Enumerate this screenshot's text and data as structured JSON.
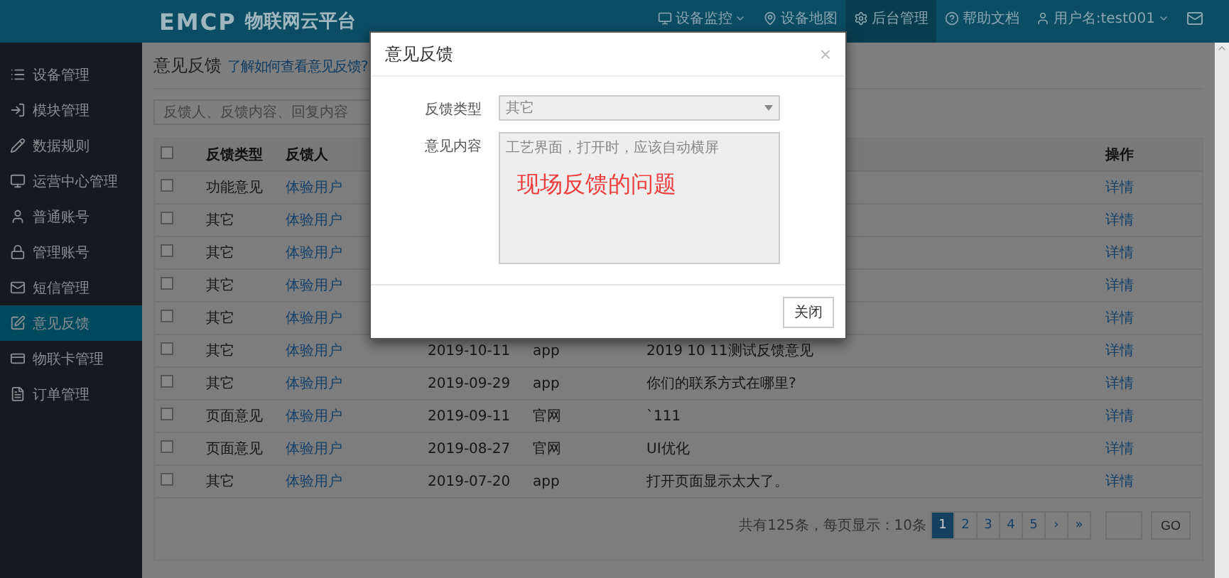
{
  "header": {
    "logo": "EMCP",
    "brand": "物联网云平台",
    "nav": [
      {
        "label": "设备监控",
        "caret": true,
        "selected": false
      },
      {
        "label": "设备地图",
        "caret": false,
        "selected": false
      },
      {
        "label": "后台管理",
        "caret": false,
        "selected": true
      },
      {
        "label": "帮助文档",
        "caret": false,
        "selected": false
      },
      {
        "label": "用户名:test001",
        "caret": true,
        "selected": false
      },
      {
        "caret": false,
        "selected": false
      }
    ]
  },
  "sidebar": {
    "items": [
      {
        "label": "设备管理",
        "selected": false
      },
      {
        "label": "模块管理",
        "selected": false
      },
      {
        "label": "数据规则",
        "selected": false
      },
      {
        "label": "运营中心管理",
        "selected": false
      },
      {
        "label": "普通账号",
        "selected": false
      },
      {
        "label": "管理账号",
        "selected": false
      },
      {
        "label": "短信管理",
        "selected": false
      },
      {
        "label": "意见反馈",
        "selected": true
      },
      {
        "label": "物联卡管理",
        "selected": false
      },
      {
        "label": "订单管理",
        "selected": false
      }
    ]
  },
  "page": {
    "title": "意见反馈",
    "help_link": "了解如何查看意见反馈?",
    "search": {
      "placeholder": "反馈人、反馈内容、回复内容"
    }
  },
  "table": {
    "all_checked": false,
    "columns": [
      "反馈类型",
      "反馈人",
      "操作"
    ],
    "rows": [
      {
        "checked": false,
        "type": "功能意见",
        "person": "体验用户",
        "action": "详情"
      },
      {
        "checked": false,
        "type": "其它",
        "person": "体验用户",
        "action": "详情"
      },
      {
        "checked": false,
        "type": "其它",
        "person": "体验用户",
        "action": "详情"
      },
      {
        "checked": false,
        "type": "其它",
        "person": "体验用户",
        "action": "详情"
      },
      {
        "checked": false,
        "type": "其它",
        "person": "体验用户",
        "action": "详情"
      },
      {
        "checked": false,
        "type": "其它",
        "person": "体验用户",
        "date": "2019-10-11",
        "source": "app",
        "content": "2019 10 11测试反馈意见",
        "action": "详情"
      },
      {
        "checked": false,
        "type": "其它",
        "person": "体验用户",
        "date": "2019-09-29",
        "source": "app",
        "content": "你们的联系方式在哪里?",
        "action": "详情"
      },
      {
        "checked": false,
        "type": "页面意见",
        "person": "体验用户",
        "date": "2019-09-11",
        "source": "官网",
        "content": "`111",
        "action": "详情"
      },
      {
        "checked": false,
        "type": "页面意见",
        "person": "体验用户",
        "date": "2019-08-27",
        "source": "官网",
        "content": "UI优化",
        "action": "详情"
      },
      {
        "checked": false,
        "type": "其它",
        "person": "体验用户",
        "date": "2019-07-20",
        "source": "app",
        "content": "打开页面显示太大了。",
        "action": "详情"
      }
    ]
  },
  "pagination": {
    "summary": "共有125条，每页显示：10条",
    "pages": [
      {
        "label": "1",
        "selected": true
      },
      {
        "label": "2",
        "selected": false
      },
      {
        "label": "3",
        "selected": false
      },
      {
        "label": "4",
        "selected": false
      },
      {
        "label": "5",
        "selected": false
      },
      {
        "label": "›",
        "selected": false
      },
      {
        "label": "»",
        "selected": false
      }
    ],
    "go": "GO"
  },
  "dialog": {
    "title": "意见反馈",
    "close": "×",
    "fields": [
      {
        "kind": "select",
        "label": "反馈类型",
        "value": "其它"
      },
      {
        "kind": "textarea",
        "label": "意见内容",
        "value": "工艺界面，打开时，应该自动横屏"
      }
    ],
    "annotation": "现场反馈的问题",
    "button": "关闭"
  }
}
